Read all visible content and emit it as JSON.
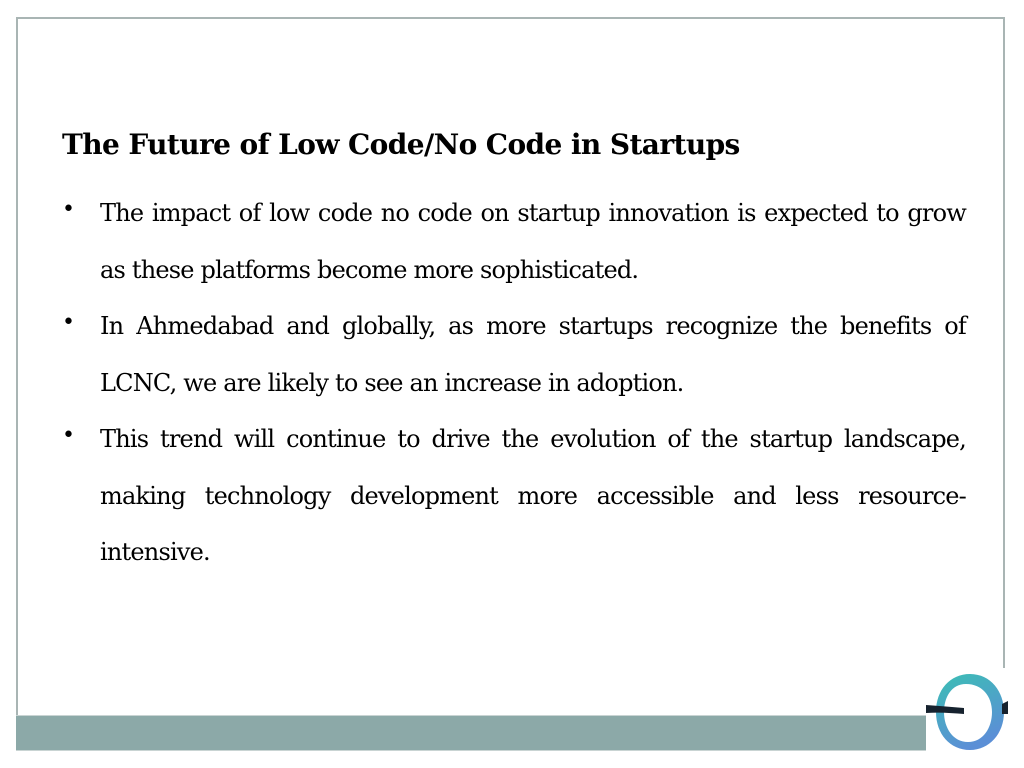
{
  "slide": {
    "title": "The Future of Low Code/No Code in Startups",
    "bullet_marker": "•",
    "bullets": [
      {
        "text": "The impact of low code no code on startup innovation is expected to grow as these platforms become more sophisticated."
      },
      {
        "text": "In Ahmedabad and globally, as more startups recognize the benefits of LCNC, we are likely to see an increase in adoption."
      },
      {
        "text": "This trend will continue to drive the evolution of the startup landscape, making technology development more accessible and less resource-intensive."
      }
    ]
  },
  "theme": {
    "border_color": "#a9b5b4",
    "footer_bar_color": "#8ca9a8",
    "logo_ring_gradient": [
      "#3bbfb4",
      "#5b8fd6"
    ],
    "logo_bar_color": "#16222e"
  },
  "logo": {
    "icon": "ring-with-bar-logo-icon"
  }
}
